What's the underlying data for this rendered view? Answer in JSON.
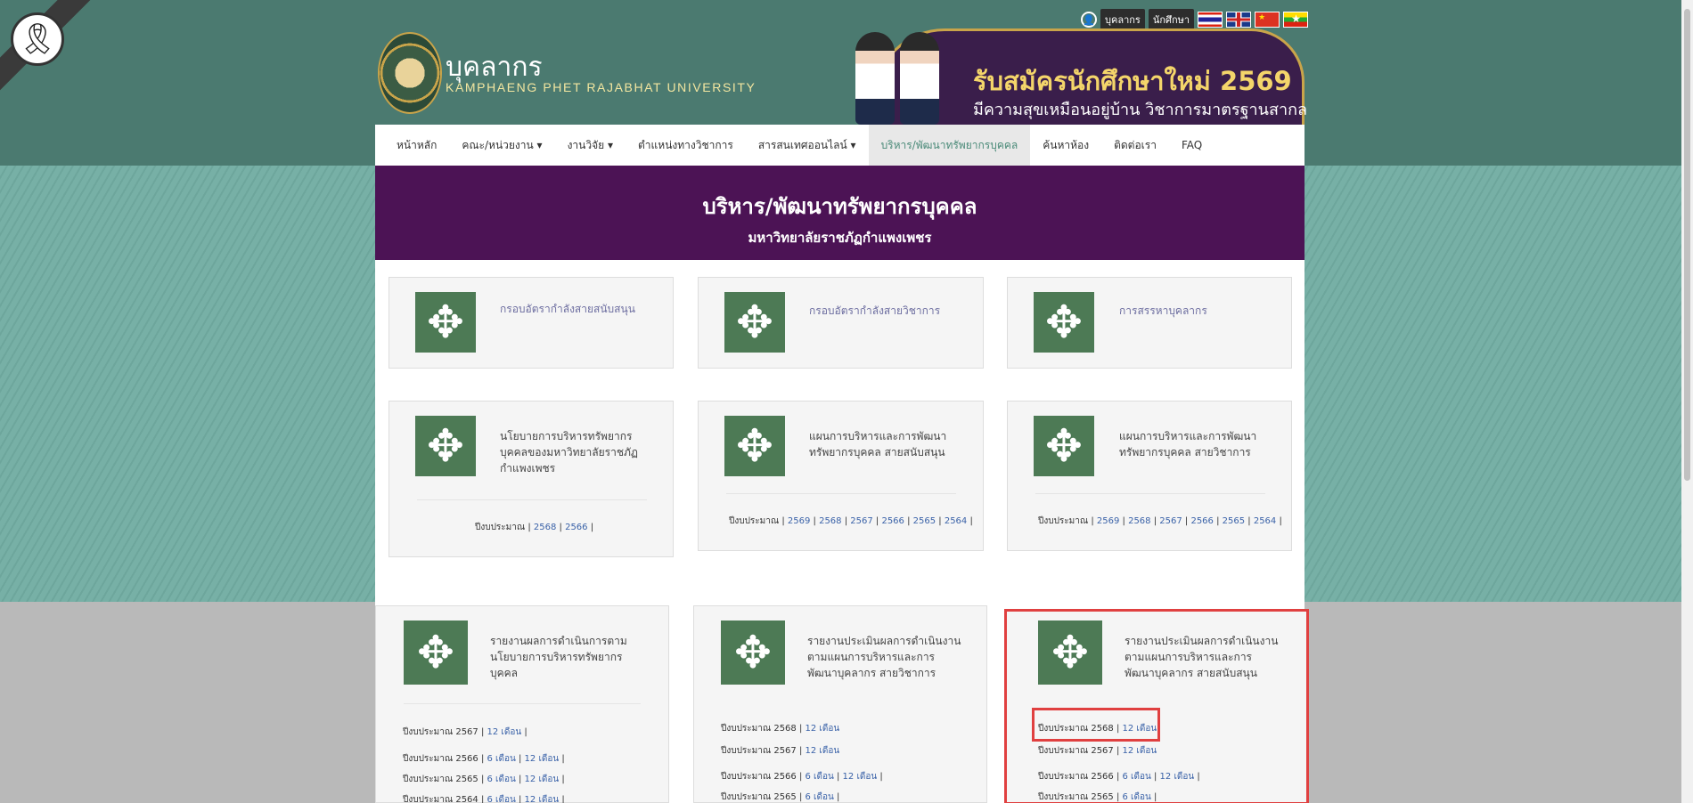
{
  "utility": {
    "staff_label": "บุคลากร",
    "student_label": "นักศึกษา",
    "user_icon": "user-icon",
    "flags": [
      "th-flag",
      "uk-flag",
      "cn-flag",
      "mm-flag"
    ]
  },
  "logo": {
    "title": "บุคลากร",
    "subtitle": "KAMPHAENG PHET RAJABHAT UNIVERSITY"
  },
  "banner": {
    "title": "รับสมัครนักศึกษาใหม่ 2569",
    "subtitle": "มีความสุขเหมือนอยู่บ้าน วิชาการมาตรฐานสากล"
  },
  "nav": {
    "items": [
      {
        "label": "หน้าหลัก"
      },
      {
        "label": "คณะ/หน่วยงาน ▾"
      },
      {
        "label": "งานวิจัย ▾"
      },
      {
        "label": "ตำแหน่งทางวิชาการ"
      },
      {
        "label": "สารสนเทศออนไลน์ ▾"
      },
      {
        "label": "บริหาร/พัฒนาทรัพยากรบุคคล"
      },
      {
        "label": "ค้นหาห้อง"
      },
      {
        "label": "ติดต่อเรา"
      },
      {
        "label": "FAQ"
      }
    ]
  },
  "header": {
    "title": "บริหาร/พัฒนาทรัพยากรบุคคล",
    "subtitle": "มหาวิทยาลัยราชภัฏกำแพงเพชร"
  },
  "cards": {
    "c1": {
      "title": "กรอบอัตรากำลังสายสนับสนุน"
    },
    "c2": {
      "title": "กรอบอัตรากำลังสายวิชาการ"
    },
    "c3": {
      "title": "การสรรหาบุคลากร"
    },
    "c4": {
      "title_l1": "นโยบายการบริหารทรัพยากร",
      "title_l2": "บุคคลของมหาวิทยาลัยราชภัฏ",
      "title_l3": "กำแพงเพชร",
      "budget_label": "ปีงบประมาณ | ",
      "years": [
        "2568",
        "2566"
      ]
    },
    "c5": {
      "title_l1": "แผนการบริหารและการพัฒนา",
      "title_l2": "ทรัพยากรบุคคล สายสนับสนุน",
      "budget_label": "ปีงบประมาณ | ",
      "years": [
        "2569",
        "2568",
        "2567",
        "2566",
        "2565",
        "2564"
      ]
    },
    "c6": {
      "title_l1": "แผนการบริหารและการพัฒนา",
      "title_l2": "ทรัพยากรบุคคล สายวิชาการ",
      "budget_label": "ปีงบประมาณ | ",
      "years": [
        "2569",
        "2568",
        "2567",
        "2566",
        "2565",
        "2564"
      ]
    },
    "c7": {
      "title_l1": "รายงานผลการดำเนินการตาม",
      "title_l2": "นโยบายการบริหารทรัพยากร",
      "title_l3": "บุคคล",
      "rows": [
        {
          "label": "ปีงบประมาณ 2567 | ",
          "l1": "12 เดือน",
          "l2": ""
        },
        {
          "label": "ปีงบประมาณ 2566 | ",
          "l1": "6 เดือน",
          "l2": "12 เดือน"
        },
        {
          "label": "ปีงบประมาณ 2565 | ",
          "l1": "6 เดือน",
          "l2": "12 เดือน"
        },
        {
          "label": "ปีงบประมาณ 2564 | ",
          "l1": "6 เดือน",
          "l2": "12 เดือน"
        }
      ]
    },
    "c8": {
      "title_l1": "รายงานประเมินผลการดำเนินงาน",
      "title_l2": "ตามแผนการบริหารและการ",
      "title_l3": "พัฒนาบุคลากร สายวิชาการ",
      "rows": [
        {
          "label": "ปีงบประมาณ 2568 | ",
          "l1": "12 เดือน",
          "l2": ""
        },
        {
          "label": "ปีงบประมาณ 2567 | ",
          "l1": "12 เดือน",
          "l2": ""
        },
        {
          "label": "ปีงบประมาณ 2566 | ",
          "l1": "6 เดือน",
          "l2": "12 เดือน"
        },
        {
          "label": "ปีงบประมาณ 2565 | ",
          "l1": "6 เดือน",
          "l2": ""
        }
      ]
    },
    "c9": {
      "title_l1": "รายงานประเมินผลการดำเนินงาน",
      "title_l2": "ตามแผนการบริหารและการ",
      "title_l3": "พัฒนาบุคลากร สายสนับสนุน",
      "rows": [
        {
          "label": "ปีงบประมาณ 2568 | ",
          "l1": "12 เดือน",
          "l2": ""
        },
        {
          "label": "ปีงบประมาณ 2567 | ",
          "l1": "12 เดือน",
          "l2": ""
        },
        {
          "label": "ปีงบประมาณ 2566 | ",
          "l1": "6 เดือน",
          "l2": "12 เดือน"
        },
        {
          "label": "ปีงบประมาณ 2565 | ",
          "l1": "6 เดือน",
          "l2": ""
        }
      ]
    }
  },
  "card_icon": "move-arrows-icon",
  "colors": {
    "top_bg": "#4b7a70",
    "header_bg": "#4c1355",
    "icon_bg": "#4d7a55",
    "link": "#3a62a8",
    "highlight": "#e04040"
  }
}
